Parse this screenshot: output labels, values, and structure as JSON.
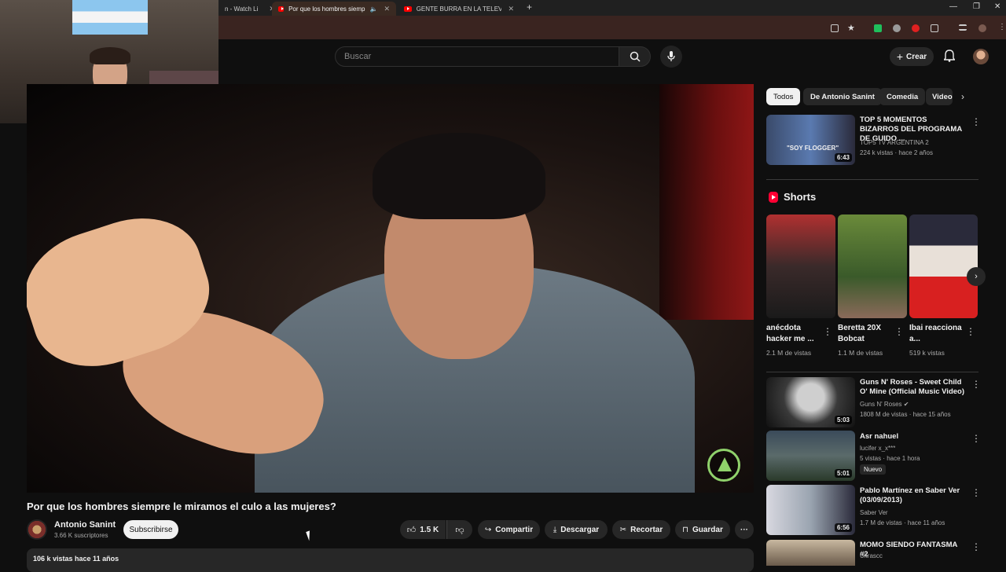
{
  "browser": {
    "tabs": [
      {
        "title": "n - Watch Li",
        "active": false
      },
      {
        "title": "Por que los hombres siemp",
        "active": true
      },
      {
        "title": "GENTE BURRA EN LA TELEVISIÓ",
        "active": false
      }
    ],
    "controls": {
      "minimize": "—",
      "maximize": "❐",
      "close": "✕",
      "new_tab": "+"
    }
  },
  "header": {
    "search_placeholder": "Buscar",
    "create_label": "Crear"
  },
  "video": {
    "title": "Por que los hombres siempre le miramos el culo a las mujeres?",
    "channel": "Antonio Sanint",
    "subscribers": "3.66 K suscriptores",
    "subscribe_label": "Subscribirse",
    "likes": "1.5 K",
    "share_label": "Compartir",
    "download_label": "Descargar",
    "clip_label": "Recortar",
    "save_label": "Guardar",
    "views_date": "106 k vistas  hace 11 años"
  },
  "chips": [
    "Todos",
    "De Antonio Sanint",
    "Comedia",
    "Video"
  ],
  "recommended_top": {
    "title": "TOP 5 MOMENTOS BIZARROS DEL PROGRAMA DE GUIDO ...",
    "channel": "TOP5 TV ARGENTINA 2",
    "meta": "224 k vistas · hace 2 años",
    "duration": "6:43",
    "thumb_caption": "\"SOY FLOGGER\""
  },
  "shorts": {
    "heading": "Shorts",
    "items": [
      {
        "title": "anécdota hacker me ...",
        "views": "2.1 M de vistas"
      },
      {
        "title": "Beretta 20X Bobcat",
        "views": "1.1 M de vistas"
      },
      {
        "title": "Ibai reacciona a...",
        "views": "519 k vistas"
      }
    ]
  },
  "recommended": [
    {
      "title": "Guns N' Roses - Sweet Child O' Mine (Official Music Video)",
      "channel": "Guns N' Roses",
      "meta": "1808 M de vistas · hace 15 años",
      "duration": "5:03",
      "badge": ""
    },
    {
      "title": "Asr nahuel",
      "channel": "lucifer x_x***",
      "meta": "5 vistas · hace 1 hora",
      "duration": "5:01",
      "badge": "Nuevo"
    },
    {
      "title": "Pablo Martínez en Saber Ver (03/09/2013)",
      "channel": "Saber Ver",
      "meta": "1.7 M de vistas · hace 11 años",
      "duration": "6:56",
      "badge": ""
    },
    {
      "title": "MOMO SIENDO FANTASMA #2",
      "channel": "Ultrascc",
      "meta": "",
      "duration": "",
      "badge": ""
    }
  ]
}
